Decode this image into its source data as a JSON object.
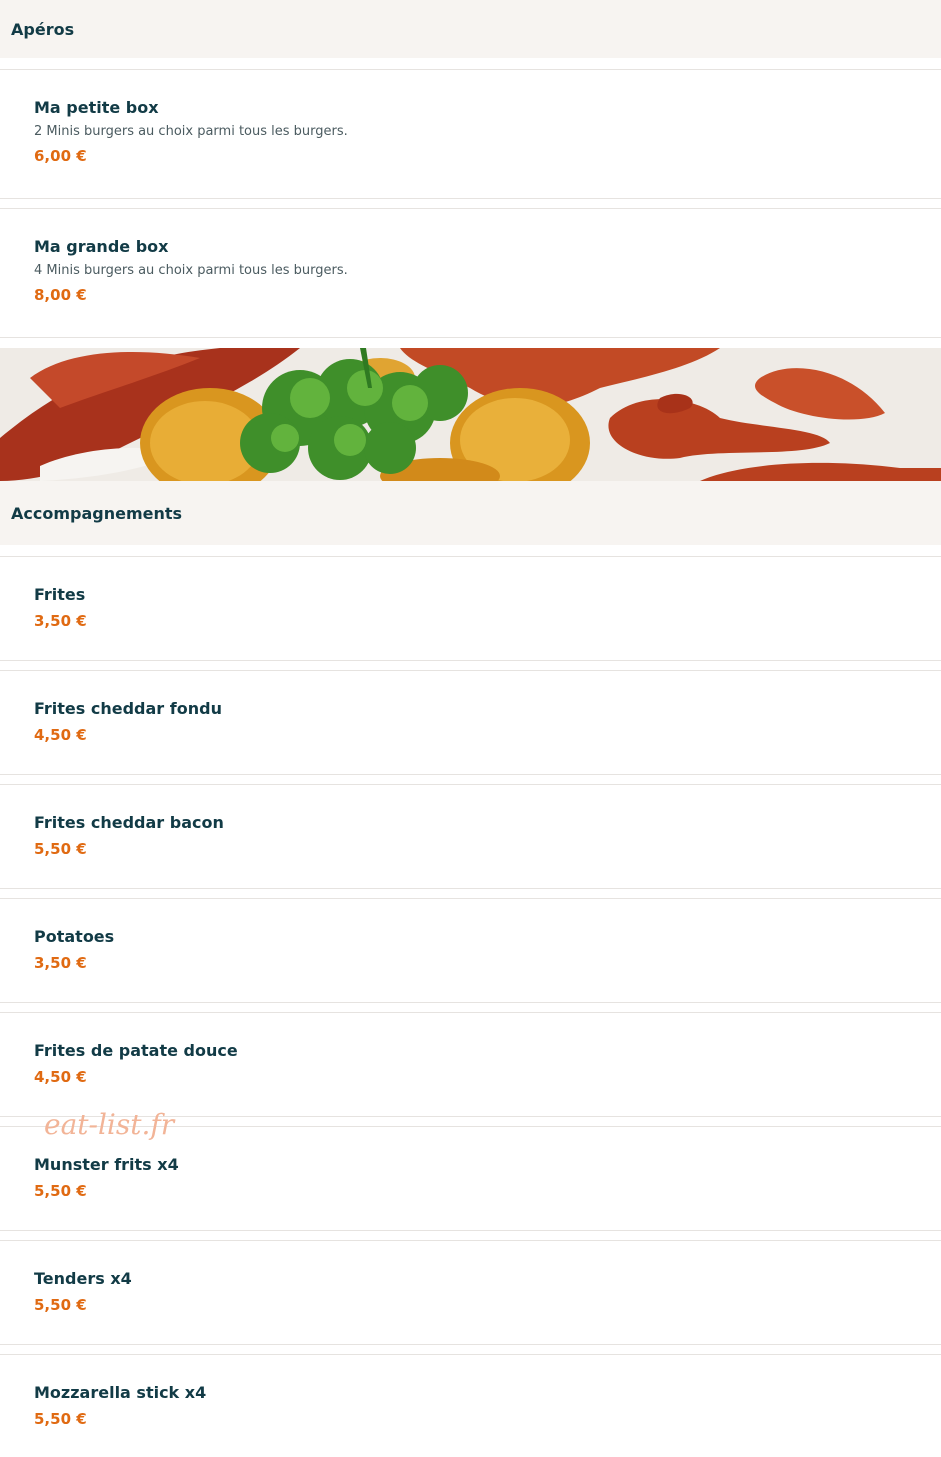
{
  "sections": [
    {
      "title": "Apéros",
      "items": [
        {
          "name": "Ma petite box",
          "description": "2 Minis burgers au choix parmi tous les burgers.",
          "price": "6,00 €"
        },
        {
          "name": "Ma grande box",
          "description": "4 Minis burgers au choix parmi tous les burgers.",
          "price": "8,00 €"
        }
      ]
    },
    {
      "title": "Accompagnements",
      "items": [
        {
          "name": "Frites",
          "price": "3,50 €"
        },
        {
          "name": "Frites cheddar fondu",
          "price": "4,50 €"
        },
        {
          "name": "Frites cheddar bacon",
          "price": "5,50 €"
        },
        {
          "name": "Potatoes",
          "price": "3,50 €"
        },
        {
          "name": "Frites de patate douce",
          "price": "4,50 €"
        },
        {
          "name": "Munster frits x4",
          "price": "5,50 €"
        },
        {
          "name": "Tenders x4",
          "price": "5,50 €"
        },
        {
          "name": "Mozzarella stick x4",
          "price": "5,50 €"
        }
      ]
    }
  ],
  "watermark": "eat-list.fr",
  "colors": {
    "accent": "#e06a12",
    "text": "#123b46",
    "section_bg": "#f7f4f1"
  }
}
